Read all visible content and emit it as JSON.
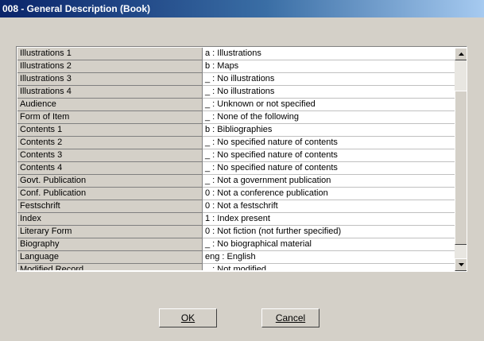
{
  "window": {
    "title": "008 - General Description (Book)"
  },
  "rows": [
    {
      "label": "Illustrations 1",
      "value": "a : Illustrations"
    },
    {
      "label": "Illustrations 2",
      "value": "b : Maps"
    },
    {
      "label": "Illustrations 3",
      "value": "_ : No illustrations"
    },
    {
      "label": "Illustrations 4",
      "value": "_ : No illustrations"
    },
    {
      "label": "Audience",
      "value": "_ : Unknown or not specified"
    },
    {
      "label": "Form of Item",
      "value": "_ : None of the following"
    },
    {
      "label": "Contents 1",
      "value": "b : Bibliographies"
    },
    {
      "label": "Contents 2",
      "value": "_ : No specified nature of contents"
    },
    {
      "label": "Contents 3",
      "value": "_ : No specified nature of contents"
    },
    {
      "label": "Contents 4",
      "value": "_ : No specified nature of contents"
    },
    {
      "label": "Govt. Publication",
      "value": "_ : Not a government publication"
    },
    {
      "label": "Conf. Publication",
      "value": "0 : Not a conference publication"
    },
    {
      "label": "Festschrift",
      "value": "0 : Not a festschrift"
    },
    {
      "label": "Index",
      "value": "1 : Index present"
    },
    {
      "label": "Literary Form",
      "value": "0 : Not fiction (not further specified)"
    },
    {
      "label": "Biography",
      "value": "_ : No biographical material"
    },
    {
      "label": "Language",
      "value": "eng : English"
    },
    {
      "label": "Modified Record",
      "value": "_ : Not modified"
    }
  ],
  "buttons": {
    "ok": "OK",
    "cancel": "Cancel"
  },
  "icons": {
    "scroll_up": "arrow-up-icon",
    "scroll_down": "arrow-down-icon"
  }
}
